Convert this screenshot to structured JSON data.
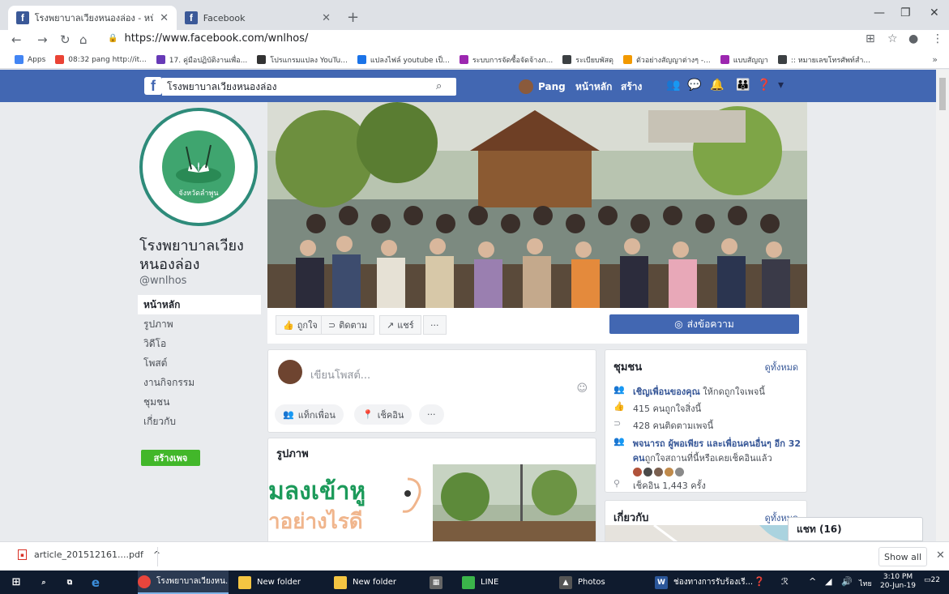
{
  "browser": {
    "tabs": [
      {
        "title": "โรงพยาบาลเวียงหนองล่อง - หน้าหลัก",
        "active": true
      },
      {
        "title": "Facebook",
        "active": false
      }
    ],
    "url": "https://www.facebook.com/wnlhos/",
    "bookmarks": [
      {
        "label": "Apps",
        "color": "#4285f4"
      },
      {
        "label": "08:32 pang http://it...",
        "color": "#ea4335"
      },
      {
        "label": "17. คู่มือปฏิบัติงานเพื่อ...",
        "color": "#673ab7"
      },
      {
        "label": "โปรแกรมแปลง YouTu...",
        "color": "#333333"
      },
      {
        "label": "แปลงไฟล์ youtube เป็...",
        "color": "#1a73e8"
      },
      {
        "label": "ระบบการจัดซื้อจัดจ้างภ...",
        "color": "#9c27b0"
      },
      {
        "label": "ระเบียบพัสดุ",
        "color": "#3c4043"
      },
      {
        "label": "ตัวอย่างสัญญาต่างๆ -...",
        "color": "#f29900"
      },
      {
        "label": "แบบสัญญา",
        "color": "#9c27b0"
      },
      {
        "label": ":: หมายเลขโทรศัพท์สำ...",
        "color": "#3c4043"
      }
    ],
    "downloads": {
      "file": "article_201512161....pdf",
      "show_all": "Show all"
    }
  },
  "fb": {
    "search_value": "โรงพยาบาลเวียงหนองล่อง",
    "user": "Pang",
    "nav_home": "หน้าหลัก",
    "nav_create": "สร้าง"
  },
  "page": {
    "name": "โรงพยาบาลเวียงหนองล่อง",
    "handle": "@wnlhos",
    "logo_text": "จังหวัดลำพูน",
    "nav": [
      "หน้าหลัก",
      "รูปภาพ",
      "วิดีโอ",
      "โพสต์",
      "งานกิจกรรม",
      "ชุมชน",
      "เกี่ยวกับ"
    ],
    "create_page": "สร้างเพจ",
    "actions": {
      "like": "ถูกใจ",
      "follow": "ติดตาม",
      "share": "แชร์",
      "more": "···",
      "message": "ส่งข้อความ"
    }
  },
  "composer": {
    "placeholder": "เขียนโพสต์...",
    "tag_friends": "แท็กเพื่อน",
    "check_in": "เช็คอิน",
    "more": "···"
  },
  "photos": {
    "title": "รูปภาพ",
    "text1": "มลงเข้าหู",
    "text2": "ำอย่างไรดี"
  },
  "community": {
    "title": "ชุมชน",
    "see_all": "ดูทั้งหมด",
    "invite": "เชิญเพื่อนของคุณ",
    "invite_suffix": "ให้กดถูกใจเพจนี้",
    "likes": "415 คนถูกใจสิ่งนี้",
    "follows": "428 คนติดตามเพจนี้",
    "friends_link": "พจนารถ ผู้พอเพียร และเพื่อนคนอื่นๆ อีก 32 คน",
    "friends_suffix": "ถูกใจสถานที่นี้หรือเคยเช็คอินแล้ว",
    "checkins": "เช็คอิน 1,443 ครั้ง"
  },
  "about": {
    "title": "เกี่ยวกับ",
    "see_all": "ดูทั้งหมด"
  },
  "chat": {
    "label": "แชท (16)"
  },
  "taskbar": {
    "apps": [
      "โรงพยาบาลเวียงหน...",
      "New folder",
      "New folder",
      "LINE",
      "Photos",
      "ช่องทางการรับร้องเรี..."
    ],
    "time": "3:10 PM",
    "date": "20-Jun-19",
    "lang": "ไทย",
    "notif": "22"
  }
}
